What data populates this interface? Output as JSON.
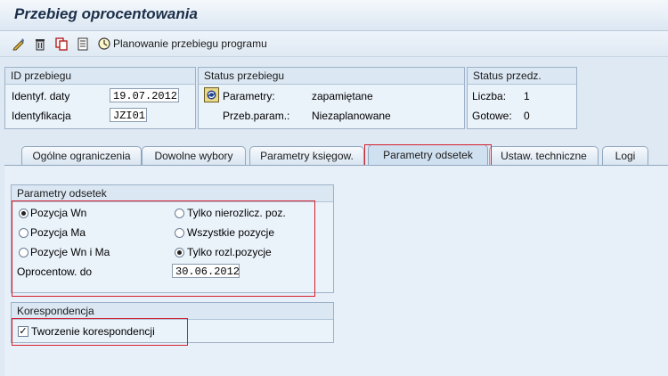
{
  "title": "Przebieg oprocentowania",
  "toolbar": {
    "icons": [
      "pencil-icon",
      "trash-icon",
      "copy-icon",
      "list-icon",
      "clock-icon"
    ],
    "schedule_label": "Planowanie przebiegu programu"
  },
  "id_panel": {
    "header": "ID przebiegu",
    "date_label": "Identyf. daty",
    "date_value": "19.07.2012",
    "id_label": "Identyfikacja",
    "id_value": "JZI01"
  },
  "status_panel": {
    "header": "Status przebiegu",
    "params_label": "Parametry:",
    "params_value": "zapamiętane",
    "run_label": "Przeb.param.:",
    "run_value": "Niezaplanowane"
  },
  "prev_panel": {
    "header": "Status przedz.",
    "count_label": "Liczba:",
    "count_value": "1",
    "ready_label": "Gotowe:",
    "ready_value": "0"
  },
  "tabs": [
    "Ogólne ograniczenia",
    "Dowolne wybory",
    "Parametry księgow.",
    "Parametry odsetek",
    "Ustaw. techniczne",
    "Logi"
  ],
  "interest_panel": {
    "header": "Parametry odsetek",
    "radio_left": [
      "Pozycja Wn",
      "Pozycja Ma",
      "Pozycje Wn i Ma"
    ],
    "radio_right": [
      "Tylko nierozlicz. poz.",
      "Wszystkie pozycje",
      "Tylko rozl.pozycje"
    ],
    "selected_left": 0,
    "selected_right": 2,
    "until_label": "Oprocentow. do",
    "until_value": "30.06.2012"
  },
  "corr_panel": {
    "header": "Korespondencja",
    "checkbox_label": "Tworzenie korespondencji",
    "checked": true
  },
  "colors": {
    "highlight": "#d51f2f",
    "title": "#1c2f4a"
  }
}
